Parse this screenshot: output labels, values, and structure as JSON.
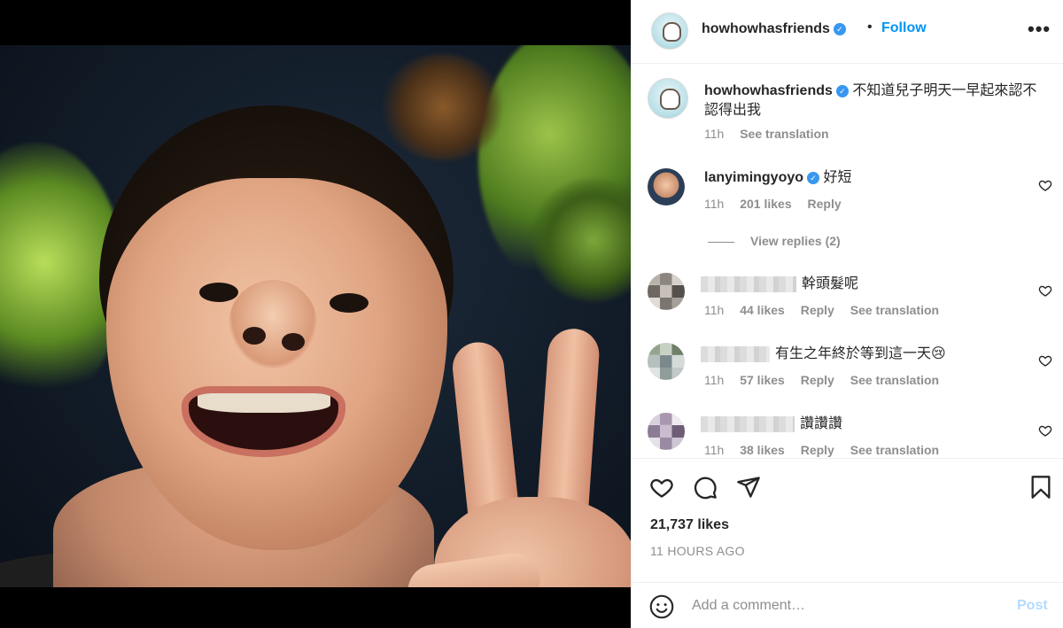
{
  "post": {
    "username": "howhowhasfriends",
    "follow_label": "Follow",
    "dot": "•",
    "more_label": "•••",
    "caption_text": "不知道兒子明天一早起來認不認得出我",
    "caption_time": "11h",
    "caption_translate": "See translation",
    "likes": "21,737 likes",
    "time_ago": "11 HOURS AGO"
  },
  "comments": [
    {
      "username": "lanyimingyoyo",
      "text": "好短",
      "time": "11h",
      "likes": "201 likes",
      "reply": "Reply",
      "view_replies": "View replies (2)"
    },
    {
      "text": "幹頭髮呢",
      "time": "11h",
      "likes": "44 likes",
      "reply": "Reply",
      "translate": "See translation"
    },
    {
      "text": "有生之年終於等到這一天😢",
      "time": "11h",
      "likes": "57 likes",
      "reply": "Reply",
      "translate": "See translation"
    },
    {
      "text": "讚讚讚",
      "time": "11h",
      "likes": "38 likes",
      "reply": "Reply",
      "translate": "See translation"
    }
  ],
  "comment_box": {
    "placeholder": "Add a comment…",
    "post_label": "Post"
  },
  "icons": {
    "verified": "verified-badge-icon",
    "like": "heart-icon",
    "comment": "comment-icon",
    "share": "paper-plane-icon",
    "save": "bookmark-icon",
    "emoji": "smiley-icon",
    "options": "more-horizontal-icon"
  },
  "colors": {
    "accent": "#0095f6",
    "verified": "#3897f0",
    "post_disabled": "#b3dbff",
    "muted_text": "#8e8e8e",
    "text": "#262626"
  }
}
